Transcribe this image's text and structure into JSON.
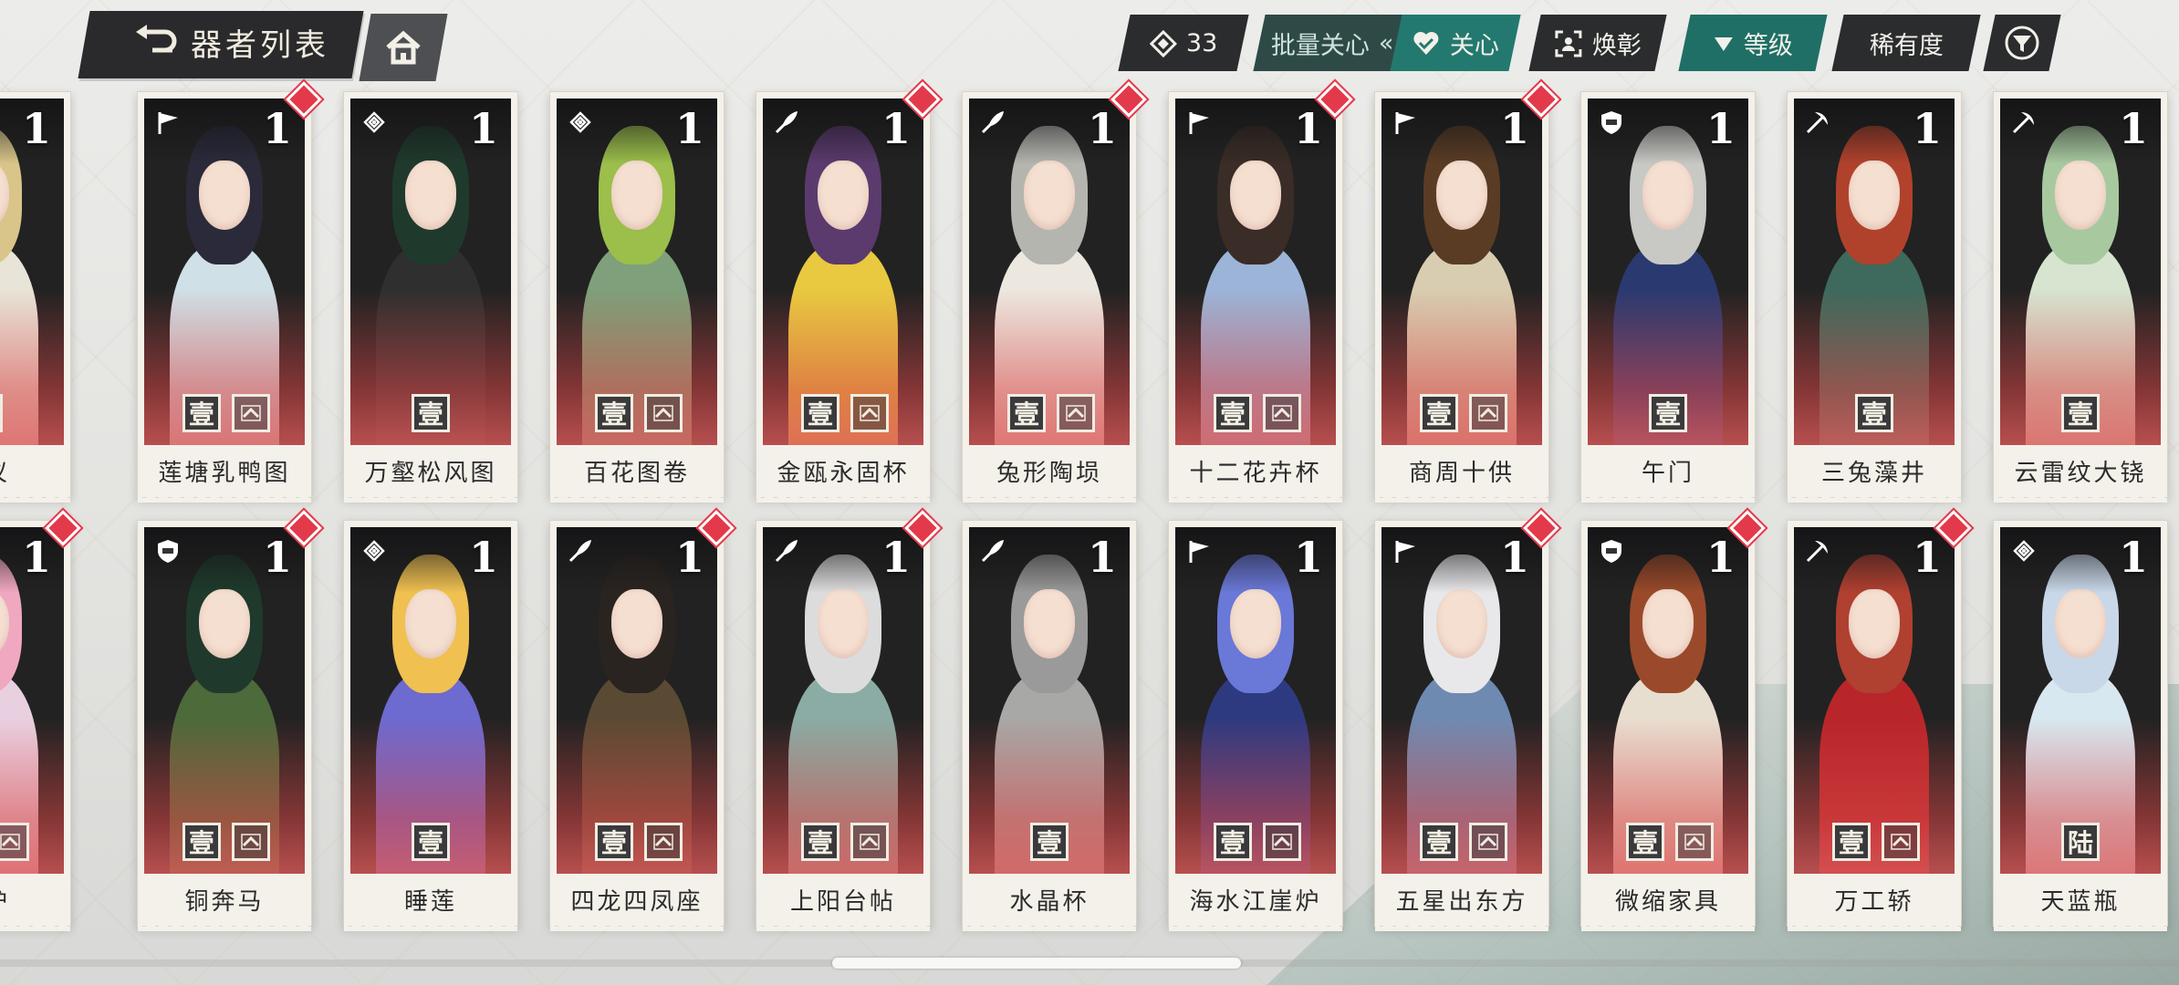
{
  "header": {
    "title": "器者列表",
    "back_icon": "back-arrow-icon",
    "home_icon": "home-icon"
  },
  "toolbar": {
    "count": "33",
    "batch_care": "批量关心",
    "batch_arrows": "«",
    "care": "关心",
    "huanzhang": "焕彰",
    "level_sort": "等级",
    "rarity": "稀有度",
    "filter_icon": "filter-icon"
  },
  "colors": {
    "teal": "#23796f",
    "dark": "#2b2c2e",
    "accent_red": "#e23a4a"
  },
  "cards": {
    "row1": [
      {
        "name": "天仪",
        "level": "1",
        "rank": "贰",
        "icon": "sun-icon",
        "new": false,
        "chev": false,
        "hair": "#d9c58a",
        "body": "#e8e4d8"
      },
      {
        "name": "莲塘乳鸭图",
        "level": "1",
        "rank": "壹",
        "icon": "flag-icon",
        "new": true,
        "chev": true,
        "hair": "#2a2a3a",
        "body": "#cfe0e6"
      },
      {
        "name": "万壑松风图",
        "level": "1",
        "rank": "壹",
        "icon": "knot-icon",
        "new": false,
        "chev": false,
        "hair": "#1f3a2c",
        "body": "#2f2f2f"
      },
      {
        "name": "百花图卷",
        "level": "1",
        "rank": "壹",
        "icon": "knot-icon",
        "new": false,
        "chev": true,
        "hair": "#9bbf4a",
        "body": "#7ea07a"
      },
      {
        "name": "金瓯永固杯",
        "level": "1",
        "rank": "壹",
        "icon": "quill-icon",
        "new": true,
        "chev": true,
        "hair": "#5b3a6e",
        "body": "#e8c940"
      },
      {
        "name": "兔形陶埙",
        "level": "1",
        "rank": "壹",
        "icon": "quill-icon",
        "new": true,
        "chev": true,
        "hair": "#b5b5b0",
        "body": "#ece8e0"
      },
      {
        "name": "十二花卉杯",
        "level": "1",
        "rank": "壹",
        "icon": "flag-icon",
        "new": true,
        "chev": true,
        "hair": "#3a2c26",
        "body": "#9bb4d8"
      },
      {
        "name": "商周十供",
        "level": "1",
        "rank": "壹",
        "icon": "flag-icon",
        "new": true,
        "chev": true,
        "hair": "#5a3c25",
        "body": "#d8cdb0"
      },
      {
        "name": "午门",
        "level": "1",
        "rank": "壹",
        "icon": "shield-icon",
        "new": false,
        "chev": false,
        "hair": "#c8c8c4",
        "body": "#2a3a70"
      },
      {
        "name": "三兔藻井",
        "level": "1",
        "rank": "壹",
        "icon": "pick-icon",
        "new": false,
        "chev": false,
        "hair": "#b0422c",
        "body": "#3d6a5c"
      },
      {
        "name": "云雷纹大铙",
        "level": "1",
        "rank": "壹",
        "icon": "pick-icon",
        "new": false,
        "chev": false,
        "hair": "#a8c9a0",
        "body": "#d7e4d0"
      }
    ],
    "row2": [
      {
        "name": "鏊炉",
        "level": "1",
        "rank": "壹",
        "icon": "flag-icon",
        "new": true,
        "chev": true,
        "hair": "#f0a8c0",
        "body": "#e9d0e0"
      },
      {
        "name": "铜奔马",
        "level": "1",
        "rank": "壹",
        "icon": "shield-icon",
        "new": true,
        "chev": true,
        "hair": "#1f3a2c",
        "body": "#4c6a3a"
      },
      {
        "name": "睡莲",
        "level": "1",
        "rank": "壹",
        "icon": "knot-icon",
        "new": false,
        "chev": false,
        "hair": "#f0c050",
        "body": "#6d6ad0"
      },
      {
        "name": "四龙四凤座",
        "level": "1",
        "rank": "壹",
        "icon": "quill-icon",
        "new": true,
        "chev": true,
        "hair": "#2a2420",
        "body": "#5a4a34"
      },
      {
        "name": "上阳台帖",
        "level": "1",
        "rank": "壹",
        "icon": "quill-icon",
        "new": true,
        "chev": true,
        "hair": "#dcdcdc",
        "body": "#8aaca4"
      },
      {
        "name": "水晶杯",
        "level": "1",
        "rank": "壹",
        "icon": "quill-icon",
        "new": false,
        "chev": false,
        "hair": "#9a9a9a",
        "body": "#a8a8a6"
      },
      {
        "name": "海水江崖炉",
        "level": "1",
        "rank": "壹",
        "icon": "flag-icon",
        "new": false,
        "chev": true,
        "hair": "#6a78d8",
        "body": "#2e3a80"
      },
      {
        "name": "五星出东方",
        "level": "1",
        "rank": "壹",
        "icon": "flag-icon",
        "new": true,
        "chev": true,
        "hair": "#e8e8ea",
        "body": "#6f8ab0"
      },
      {
        "name": "微缩家具",
        "level": "1",
        "rank": "壹",
        "icon": "shield-icon",
        "new": true,
        "chev": true,
        "hair": "#9a4a2a",
        "body": "#e8ded0"
      },
      {
        "name": "万工轿",
        "level": "1",
        "rank": "壹",
        "icon": "pick-icon",
        "new": true,
        "chev": true,
        "hair": "#b04030",
        "body": "#b8262a"
      },
      {
        "name": "天蓝瓶",
        "level": "1",
        "rank": "陆",
        "icon": "knot-icon",
        "new": false,
        "chev": false,
        "hair": "#c8d8e8",
        "body": "#d8e8f0"
      }
    ]
  }
}
